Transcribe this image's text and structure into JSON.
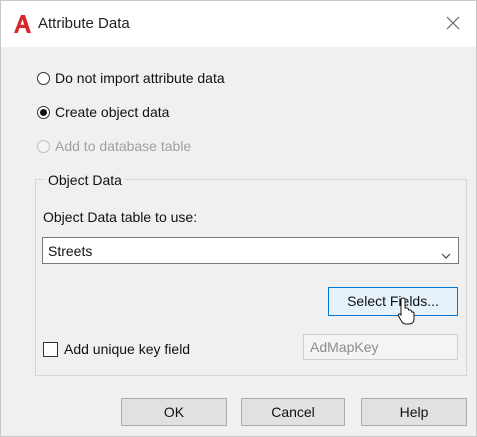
{
  "window": {
    "title": "Attribute Data",
    "app_icon": "autocad-a-icon",
    "close_icon": "close-icon",
    "accent_color": "#d8262b"
  },
  "import_options": [
    {
      "label": "Do not import attribute data",
      "checked": false,
      "enabled": true
    },
    {
      "label": "Create object data",
      "checked": true,
      "enabled": true
    },
    {
      "label": "Add to database table",
      "checked": false,
      "enabled": false
    }
  ],
  "object_data": {
    "group_title": "Object Data",
    "table_label": "Object Data table to use:",
    "table_value": "Streets",
    "select_fields_label": "Select Fields...",
    "unique_key_label": "Add unique key field",
    "unique_key_checked": false,
    "key_field_value": "AdMapKey"
  },
  "buttons": {
    "ok": "OK",
    "cancel": "Cancel",
    "help": "Help"
  }
}
